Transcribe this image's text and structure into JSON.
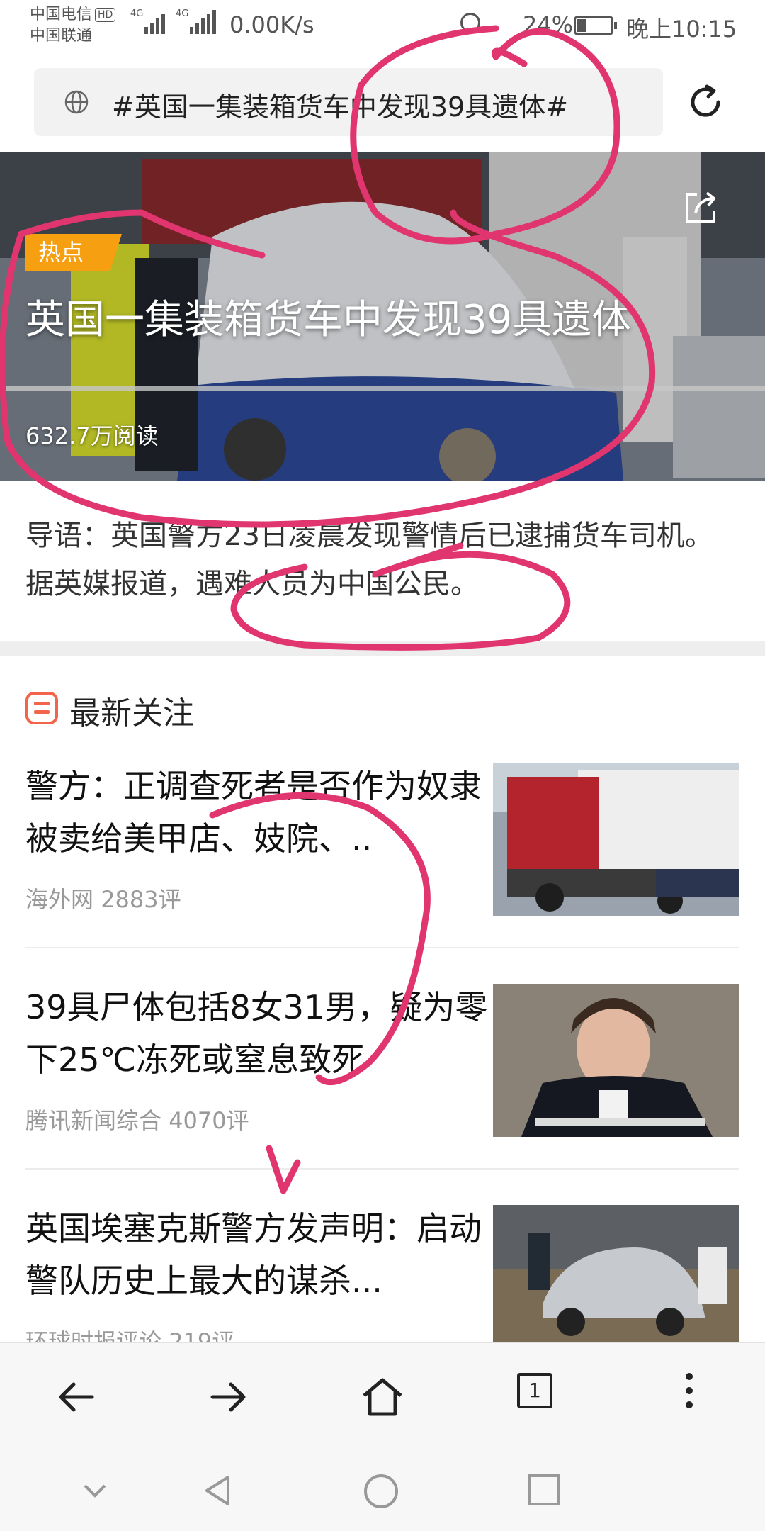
{
  "status_bar": {
    "carrier_1": "中国电信",
    "carrier_1_badge": "HD",
    "carrier_2": "中国联通",
    "network_1": "4G",
    "network_2": "4G",
    "speed": "0.00K/s",
    "battery": "24%",
    "time": "晚上10:15"
  },
  "url_bar": {
    "text": "#英国一集装箱货车中发现39具遗体#"
  },
  "hero": {
    "tag": "热点",
    "title": "英国一集装箱货车中发现39具遗体",
    "reads": "632.7万阅读"
  },
  "summary": {
    "text": "导语：英国警方23日凌晨发现警情后已逮捕货车司机。据英媒报道，遇难人员为中国公民。"
  },
  "section": {
    "title": "最新关注"
  },
  "news": [
    {
      "title": "警方：正调查死者是否作为奴隶 被卖给美甲店、妓院、..",
      "source": "海外网",
      "comments": "2883评"
    },
    {
      "title": "39具尸体包括8女31男，疑为零下25℃冻死或窒息致死",
      "source": "腾讯新闻综合",
      "comments": "4070评"
    },
    {
      "title": "英国埃塞克斯警方发声明：启动警队历史上最大的谋杀...",
      "source": "环球时报评论",
      "comments": "219评"
    }
  ],
  "toolbar": {
    "tab_count": "1"
  },
  "colors": {
    "accent_tag": "#f6a011",
    "section_icon": "#f2654a",
    "annotation": "#e0356f"
  }
}
